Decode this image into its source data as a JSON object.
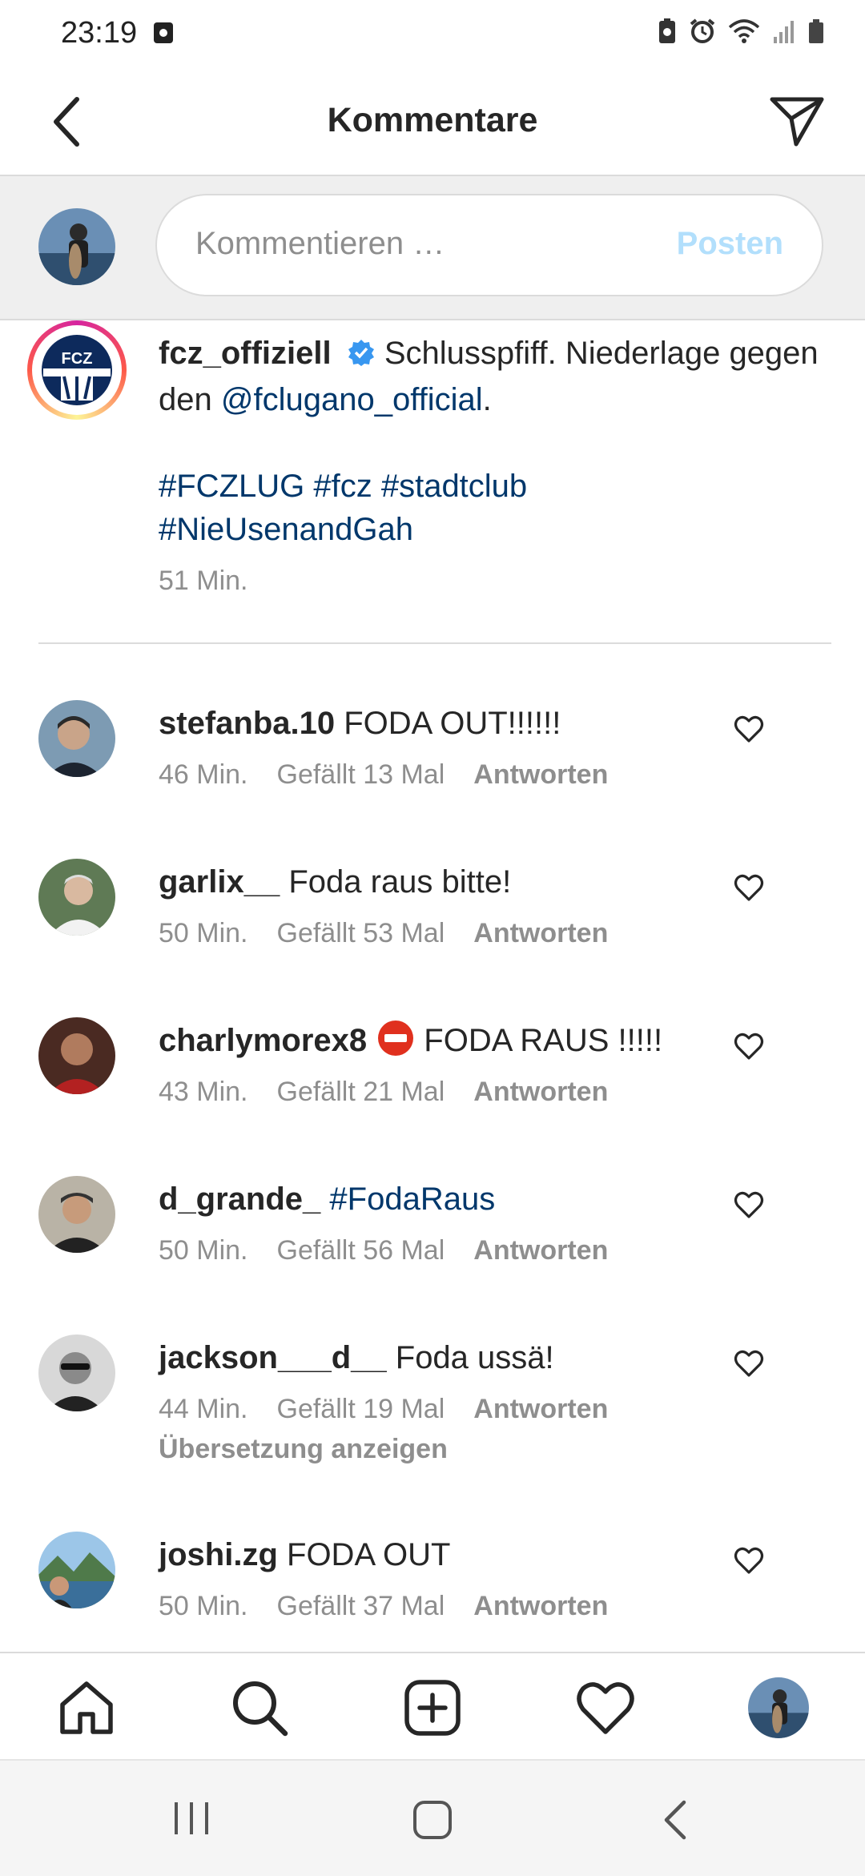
{
  "status": {
    "time": "23:19"
  },
  "header": {
    "title": "Kommentare"
  },
  "composer": {
    "placeholder": "Kommentieren …",
    "post_label": "Posten"
  },
  "caption": {
    "username": "fcz_offiziell",
    "text_1": " Schlusspfiff. Niederlage gegen den ",
    "mention": "@fclugano_official",
    "text_2": ".",
    "hashtags_line1": "#FCZLUG #fcz #stadtclub",
    "hashtags_line2": "#NieUsenandGah",
    "time": "51 Min.",
    "logo_text": "FCZ"
  },
  "comments": [
    {
      "username": "stefanba.10",
      "text": " FODA OUT!!!!!!",
      "time": "46 Min.",
      "likes": "Gefällt 13 Mal",
      "reply": "Antworten"
    },
    {
      "username": "garlix__",
      "text": " Foda raus bitte!",
      "time": "50 Min.",
      "likes": "Gefällt 53 Mal",
      "reply": "Antworten"
    },
    {
      "username": "charlymorex8",
      "text": " FODA RAUS !!!!!",
      "time": "43 Min.",
      "likes": "Gefällt 21 Mal",
      "reply": "Antworten"
    },
    {
      "username": "d_grande_",
      "text": " ",
      "hashtag": "#FodaRaus",
      "time": "50 Min.",
      "likes": "Gefällt 56 Mal",
      "reply": "Antworten"
    },
    {
      "username": "jackson___d__",
      "text": " Foda ussä!",
      "time": "44 Min.",
      "likes": "Gefällt 19 Mal",
      "reply": "Antworten",
      "translate": "Übersetzung anzeigen"
    },
    {
      "username": "joshi.zg",
      "text": " FODA OUT",
      "time": "50 Min.",
      "likes": "Gefällt 37 Mal",
      "reply": "Antworten"
    }
  ],
  "icons": {
    "back": "chevron-left-icon",
    "send": "paper-plane-icon",
    "heart": "heart-outline-icon",
    "home": "home-icon",
    "search": "search-icon",
    "add": "plus-square-icon",
    "activity": "heart-icon",
    "profile": "avatar"
  },
  "colors": {
    "link": "#00376b",
    "muted": "#8e8e8e",
    "post_disabled": "#b2dffc",
    "verified": "#3897f0"
  }
}
